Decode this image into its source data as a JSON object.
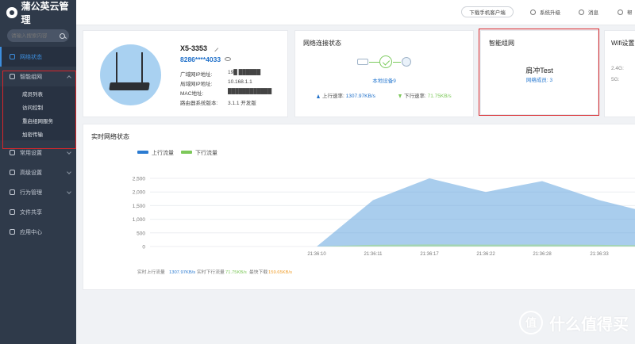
{
  "app": {
    "title": "蒲公英云管理"
  },
  "search": {
    "placeholder": "请输入搜索内容"
  },
  "sidebar": {
    "items": [
      {
        "label": "网络状态"
      },
      {
        "label": "智能组网"
      },
      {
        "label": "常用设置"
      },
      {
        "label": "高级设置"
      },
      {
        "label": "行为管理"
      },
      {
        "label": "文件共享"
      },
      {
        "label": "应用中心"
      }
    ],
    "subitems": [
      {
        "label": "成员列表"
      },
      {
        "label": "访问控制"
      },
      {
        "label": "重启组网服务"
      },
      {
        "label": "加密传输"
      }
    ]
  },
  "topbar": {
    "download_label": "下载手机客户端",
    "upgrade_label": "系统升级",
    "messages_label": "消息",
    "help_label": "帮"
  },
  "device": {
    "name": "X5-3353",
    "sn": "8286****4033",
    "rows": [
      {
        "key": "广域网IP地址:",
        "value": "19█ ██████"
      },
      {
        "key": "局域网IP地址:",
        "value": "10.168.1.1"
      },
      {
        "key": "MAC地址:",
        "value": "████████████"
      },
      {
        "key": "路由器系统版本:",
        "value": "3.1.1 开发版"
      }
    ]
  },
  "network": {
    "title": "网络连接状态",
    "local_devices": "本地设备9",
    "up_label": "上行速率:",
    "up_value": "1307.97KB/s",
    "down_label": "下行速率:",
    "down_value": "71.75KB/s"
  },
  "smart": {
    "title": "智能组网",
    "name": "肩冲Test",
    "members": "网络成员: 3"
  },
  "wifi": {
    "title": "Wifi设置",
    "band1": "2.4G:",
    "band2": "5G:"
  },
  "chart_data": {
    "type": "area",
    "title": "实时网络状态",
    "x": [
      "21:36:10",
      "21:36:11",
      "21:36:17",
      "21:36:22",
      "21:36:28",
      "21:36:33"
    ],
    "ylim": [
      0,
      2500
    ],
    "yticks": [
      "2,500",
      "2,000",
      "1,500",
      "1,000",
      "500",
      "0"
    ],
    "series": [
      {
        "name": "上行流量",
        "color": "#2b7bd1",
        "values": [
          0,
          1700,
          2500,
          2000,
          2400,
          1700
        ]
      },
      {
        "name": "下行流量",
        "color": "#7dc85a",
        "values": [
          0,
          60,
          75,
          70,
          72,
          60
        ]
      }
    ],
    "legend": "top-left",
    "grid": true,
    "footer": {
      "up_label": "实时上行流量",
      "up_value": "1307.97KB/s",
      "down_label": "实时下行流量",
      "down_value": "71.75KB/s",
      "peak_label": "最快下载",
      "peak_value": "159.65KB/s"
    }
  },
  "watermark": {
    "text": "什么值得买",
    "icon": "值"
  }
}
